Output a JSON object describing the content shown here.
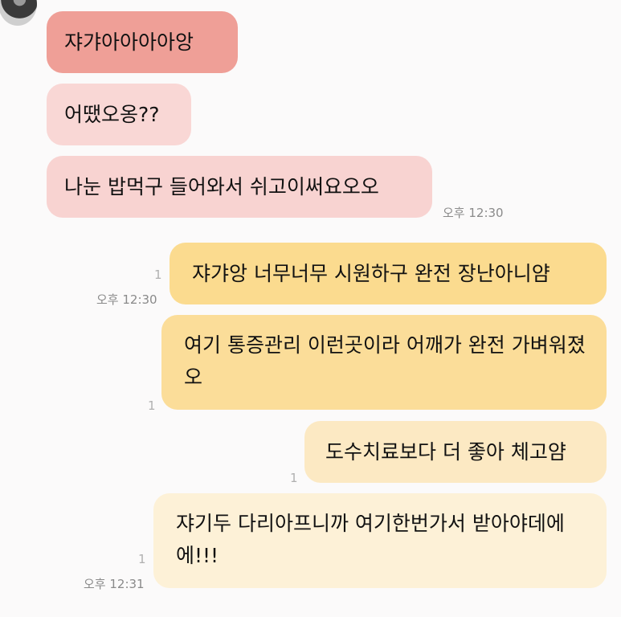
{
  "messages": [
    {
      "id": "m1",
      "side": "received",
      "text": "쟈갸아아아아앙"
    },
    {
      "id": "m2",
      "side": "received",
      "text": "어땠오옹??"
    },
    {
      "id": "m3",
      "side": "received",
      "text": "나눈 밥먹구 들어와서 쉬고이써요오오",
      "time": "오후 12:30"
    },
    {
      "id": "m4",
      "side": "sent",
      "text": "쟈갸앙 너무너무 시원하구 완전 장난아니얌",
      "unread": "1",
      "time": "오후 12:30"
    },
    {
      "id": "m5",
      "side": "sent",
      "text": "여기 통증관리 이런곳이라 어깨가 완전 가벼워졌오",
      "unread": "1"
    },
    {
      "id": "m6",
      "side": "sent",
      "text": "도수치료보다 더 좋아 체고얌",
      "unread": "1"
    },
    {
      "id": "m7",
      "side": "sent",
      "text": "쟈기두 다리아프니까 여기한번가서 받아야데에에!!!",
      "unread": "1",
      "time": "오후 12:31"
    }
  ],
  "colors": {
    "received_strong": "#ef9f97",
    "received_light": "#f9d7d5",
    "sent_yellow": "#fbdb8f",
    "sent_cream": "#fdf1d7",
    "background": "#fbfafa"
  }
}
